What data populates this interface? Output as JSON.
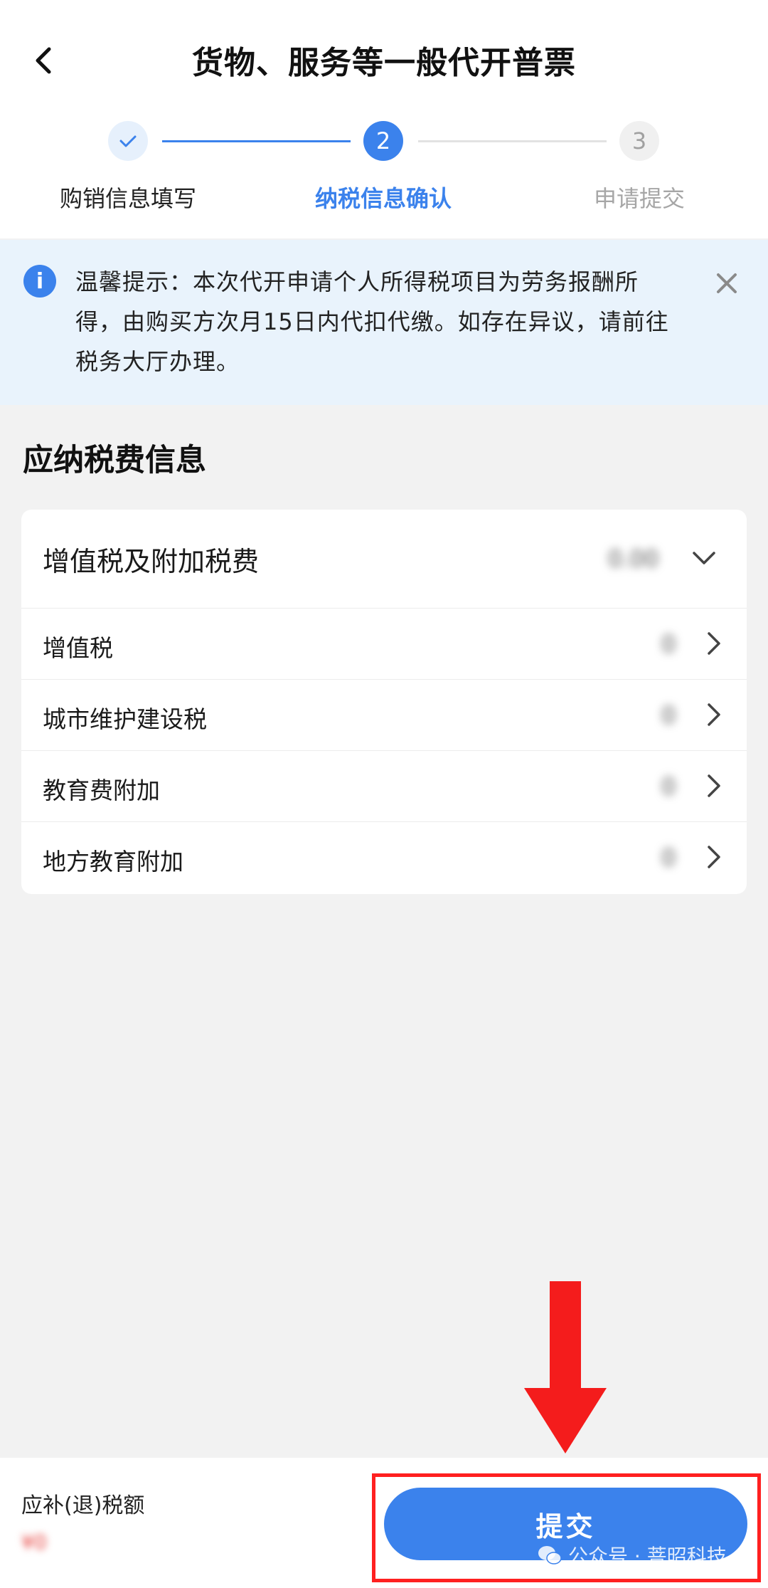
{
  "header": {
    "title": "货物、服务等一般代开普票"
  },
  "stepper": {
    "steps": [
      {
        "label": "购销信息填写",
        "state": "done"
      },
      {
        "label": "纳税信息确认",
        "number": "2",
        "state": "active"
      },
      {
        "label": "申请提交",
        "number": "3",
        "state": "todo"
      }
    ]
  },
  "notice": {
    "text": "温馨提示：本次代开申请个人所得税项目为劳务报酬所得，由购买方次月15日内代扣代缴。如存在异议，请前往税务大厅办理。"
  },
  "section": {
    "title": "应纳税费信息"
  },
  "tax_card": {
    "group_label": "增值税及附加税费",
    "group_amount": "0.00",
    "items": [
      {
        "label": "增值税",
        "amount": "0"
      },
      {
        "label": "城市维护建设税",
        "amount": "0"
      },
      {
        "label": "教育费附加",
        "amount": "0"
      },
      {
        "label": "地方教育附加",
        "amount": "0"
      }
    ]
  },
  "footer": {
    "total_label": "应补(退)税额",
    "total_value": "¥0",
    "submit_label": "提交",
    "watermark": "公众号 · 菩昭科技"
  },
  "colors": {
    "accent": "#3b82ec",
    "notice_bg": "#e9f3fc",
    "annotation_red": "#ff2020"
  }
}
